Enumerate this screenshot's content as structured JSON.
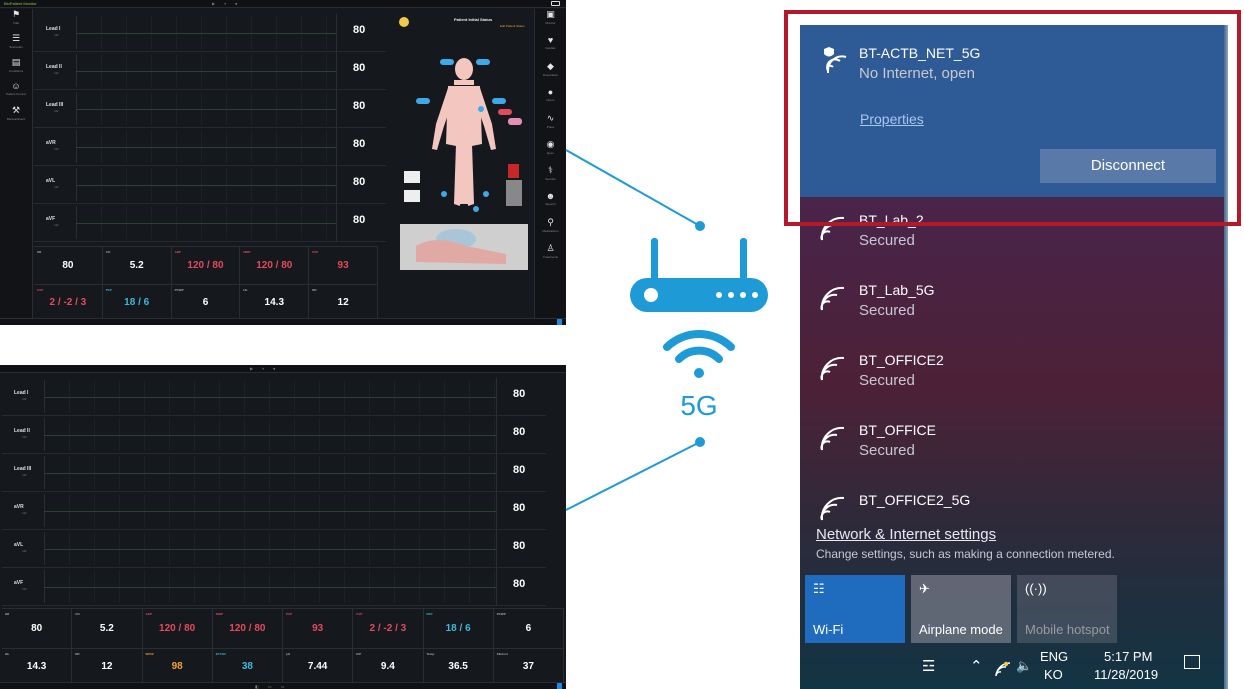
{
  "monitor_top": {
    "app_name": "BioPatient Monitor",
    "left_nav": [
      {
        "label": "Vital",
        "icon": "run-icon"
      },
      {
        "label": "Scenarios",
        "icon": "document-icon"
      },
      {
        "label": "Conditions",
        "icon": "folder-icon"
      },
      {
        "label": "Patient Control",
        "icon": "patient-icon"
      },
      {
        "label": "Manual Event",
        "icon": "tools-icon"
      }
    ],
    "right_nav": [
      {
        "label": "Monitor",
        "icon": "monitor-icon"
      },
      {
        "label": "Cardiac",
        "icon": "heart-icon"
      },
      {
        "label": "Respiration",
        "icon": "lungs-icon"
      },
      {
        "label": "Neuro",
        "icon": "brain-icon"
      },
      {
        "label": "Pulse",
        "icon": "pulse-icon"
      },
      {
        "label": "Eyes",
        "icon": "eye-icon"
      },
      {
        "label": "Sounds",
        "icon": "stethoscope-icon"
      },
      {
        "label": "Speech",
        "icon": "head-icon"
      },
      {
        "label": "Medications",
        "icon": "bike-icon"
      },
      {
        "label": "Treatments",
        "icon": "person-icon"
      }
    ],
    "leads": [
      {
        "name": "Lead I",
        "unit": "mV",
        "value": "80"
      },
      {
        "name": "Lead II",
        "unit": "mV",
        "value": "80"
      },
      {
        "name": "Lead III",
        "unit": "mV",
        "value": "80"
      },
      {
        "name": "aVR",
        "unit": "mV",
        "value": "80"
      },
      {
        "name": "aVL",
        "unit": "mV",
        "value": "80"
      },
      {
        "name": "aVF",
        "unit": "mV",
        "value": "80"
      }
    ],
    "patient_status": "Patient Initial Status",
    "status_sub": "Edit Patient Status",
    "row1": [
      {
        "label": "HR",
        "value": "80",
        "color": "w"
      },
      {
        "label": "CO",
        "value": "5.2",
        "color": "w"
      },
      {
        "label": "ABP",
        "value": "120 / 80",
        "color": "r"
      },
      {
        "label": "NIBP",
        "value": "120 / 80",
        "color": "r"
      },
      {
        "label": "PAP",
        "value": "93",
        "color": "r"
      }
    ],
    "row2": [
      {
        "label": "CVP",
        "value": "2 / -2 / 3",
        "color": "r"
      },
      {
        "label": "PAP",
        "value": "18 / 6",
        "color": "c"
      },
      {
        "label": "PCWP",
        "value": "6",
        "color": "w"
      },
      {
        "label": "Hb",
        "value": "14.3",
        "color": "w"
      },
      {
        "label": "RR",
        "value": "12",
        "color": "w"
      }
    ]
  },
  "monitor_bottom": {
    "leads": [
      {
        "name": "Lead I",
        "unit": "mV",
        "value": "80"
      },
      {
        "name": "Lead II",
        "unit": "mV",
        "value": "80"
      },
      {
        "name": "Lead III",
        "unit": "mV",
        "value": "80"
      },
      {
        "name": "aVR",
        "unit": "mV",
        "value": "80"
      },
      {
        "name": "aVL",
        "unit": "mV",
        "value": "80"
      },
      {
        "name": "aVF",
        "unit": "mV",
        "value": "80"
      }
    ],
    "row1": [
      {
        "label": "HR",
        "value": "80",
        "color": "w"
      },
      {
        "label": "CO",
        "value": "5.2",
        "color": "w"
      },
      {
        "label": "ABP",
        "value": "120 / 80",
        "color": "r"
      },
      {
        "label": "NIBP",
        "value": "120 / 80",
        "color": "r"
      },
      {
        "label": "PAP",
        "value": "93",
        "color": "r"
      },
      {
        "label": "CVP",
        "value": "2 / -2 / 3",
        "color": "r"
      },
      {
        "label": "PAP",
        "value": "18 / 6",
        "color": "c"
      },
      {
        "label": "PCWP",
        "value": "6",
        "color": "w"
      }
    ],
    "row2": [
      {
        "label": "Hb",
        "value": "14.3",
        "color": "w"
      },
      {
        "label": "RR",
        "value": "12",
        "color": "w"
      },
      {
        "label": "SPO2",
        "value": "98",
        "color": "o"
      },
      {
        "label": "ETCO2",
        "value": "38",
        "color": "c"
      },
      {
        "label": "pH",
        "value": "7.44",
        "color": "w"
      },
      {
        "label": "ICP",
        "value": "9.4",
        "color": "w"
      },
      {
        "label": "Temp",
        "value": "36.5",
        "color": "w"
      },
      {
        "label": "Fibrinol",
        "value": "37",
        "color": "w"
      }
    ]
  },
  "router": {
    "label": "5G",
    "color": "#1e9ad6"
  },
  "wifi": {
    "connected": {
      "name": "BT-ACTB_NET_5G",
      "status": "No Internet, open",
      "properties": "Properties",
      "disconnect": "Disconnect"
    },
    "networks": [
      {
        "name": "BT_Lab_2",
        "status": "Secured"
      },
      {
        "name": "BT_Lab_5G",
        "status": "Secured"
      },
      {
        "name": "BT_OFFICE2",
        "status": "Secured"
      },
      {
        "name": "BT_OFFICE",
        "status": "Secured"
      },
      {
        "name": "BT_OFFICE2_5G",
        "status": ""
      }
    ],
    "settings_link": "Network & Internet settings",
    "settings_sub": "Change settings, such as making a connection metered.",
    "tiles": [
      {
        "label": "Wi-Fi",
        "icon": "wifi-icon",
        "active": true
      },
      {
        "label": "Airplane mode",
        "icon": "airplane-icon",
        "active": false
      },
      {
        "label": "Mobile hotspot",
        "icon": "hotspot-icon",
        "active": false
      }
    ],
    "taskbar": {
      "lang1": "ENG",
      "lang2": "KO",
      "time": "5:17 PM",
      "date": "11/28/2019"
    },
    "highlight_color": "#b3182b"
  }
}
